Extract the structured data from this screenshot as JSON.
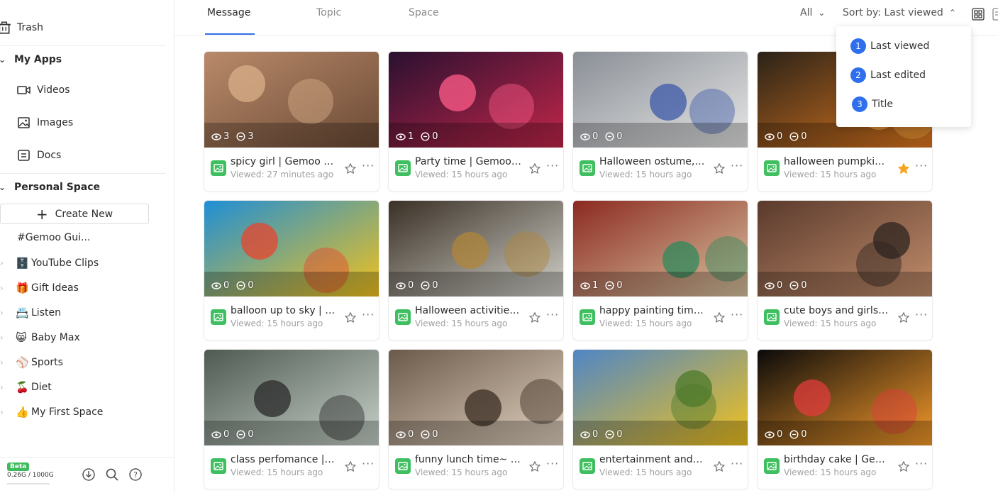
{
  "sidebar": {
    "trash": "Trash",
    "my_apps": "My Apps",
    "apps": [
      "Videos",
      "Images",
      "Docs"
    ],
    "personal_space": "Personal Space",
    "create_new": "Create New",
    "spaces": [
      {
        "emoji": "",
        "label": "#Gemoo Gui..."
      },
      {
        "emoji": "🗄️",
        "label": "YouTube Clips"
      },
      {
        "emoji": "🎁",
        "label": "Gift Ideas"
      },
      {
        "emoji": "📇",
        "label": "Listen"
      },
      {
        "emoji": "😸",
        "label": "Baby Max"
      },
      {
        "emoji": "⚾",
        "label": "Sports"
      },
      {
        "emoji": "🍒",
        "label": "Diet"
      },
      {
        "emoji": "👍",
        "label": "My First Space"
      }
    ],
    "beta": "Beta",
    "storage": "0.26G / 1000G"
  },
  "tabs": [
    "Message",
    "Topic",
    "Space"
  ],
  "filter": {
    "all": "All",
    "sort": "Sort by: Last viewed"
  },
  "sort_menu": [
    {
      "num": "1",
      "label": "Last viewed"
    },
    {
      "num": "2",
      "label": "Last edited"
    },
    {
      "num": "3",
      "label": "Title"
    }
  ],
  "cards": [
    {
      "title": "spicy girl | Gemoo Gif",
      "viewed": "Viewed: 27 minutes ago",
      "views": "3",
      "comments": "3",
      "starred": false
    },
    {
      "title": "Party time | Gemoo Gif",
      "viewed": "Viewed: 15 hours ago",
      "views": "1",
      "comments": "0",
      "starred": false
    },
    {
      "title": "Halloween ostume, Gemoo",
      "viewed": "Viewed: 15 hours ago",
      "views": "0",
      "comments": "0",
      "starred": false
    },
    {
      "title": "halloween pumpkin | Gemoo",
      "viewed": "Viewed: 15 hours ago",
      "views": "0",
      "comments": "0",
      "starred": true
    },
    {
      "title": "balloon up to sky | Gemoo",
      "viewed": "Viewed: 15 hours ago",
      "views": "0",
      "comments": "0",
      "starred": false
    },
    {
      "title": "Halloween activities | Gemoo",
      "viewed": "Viewed: 15 hours ago",
      "views": "0",
      "comments": "0",
      "starred": false
    },
    {
      "title": "happy painting time | Gemoo",
      "viewed": "Viewed: 15 hours ago",
      "views": "1",
      "comments": "0",
      "starred": false
    },
    {
      "title": "cute boys and girls | Gemoo",
      "viewed": "Viewed: 15 hours ago",
      "views": "0",
      "comments": "0",
      "starred": false
    },
    {
      "title": "class perfomance | Gemoo",
      "viewed": "Viewed: 15 hours ago",
      "views": "0",
      "comments": "0",
      "starred": false
    },
    {
      "title": "funny lunch time~ | Gemoo",
      "viewed": "Viewed: 15 hours ago",
      "views": "0",
      "comments": "0",
      "starred": false
    },
    {
      "title": "entertainment and fun",
      "viewed": "Viewed: 15 hours ago",
      "views": "0",
      "comments": "0",
      "starred": false
    },
    {
      "title": "birthday cake | Gemoo",
      "viewed": "Viewed: 15 hours ago",
      "views": "0",
      "comments": "0",
      "starred": false
    }
  ],
  "colors": {
    "accent": "#2f6fed",
    "app_green": "#3fbf60",
    "star_active": "#f5a623"
  }
}
